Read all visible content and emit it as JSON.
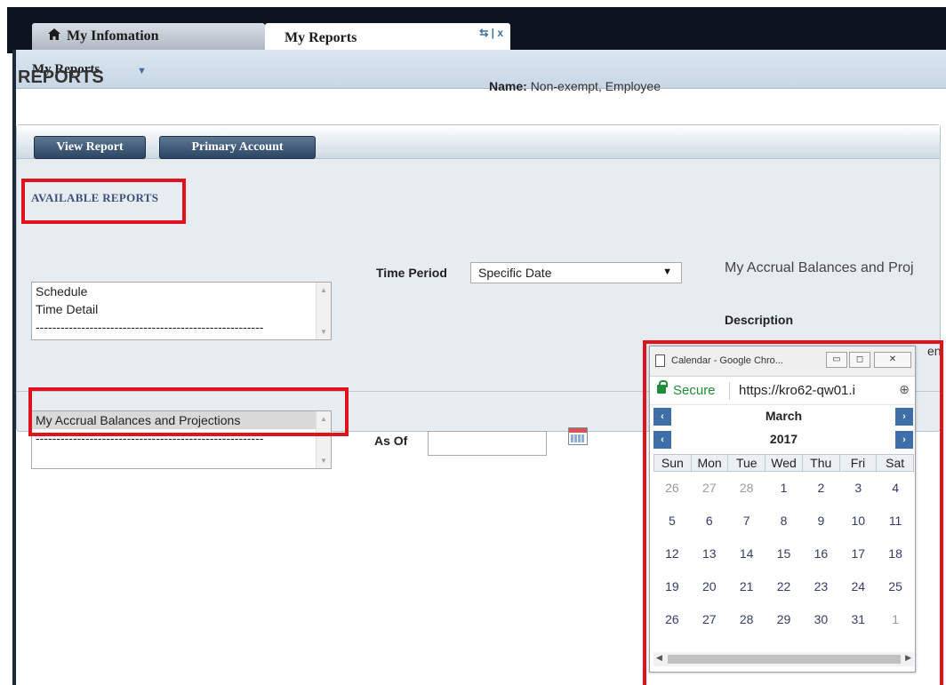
{
  "tabs": {
    "my_information": "My Infomation",
    "my_reports": "My Reports",
    "tools": "⇆ | x"
  },
  "subheader": {
    "title": "My Reports"
  },
  "page": {
    "title": "REPORTS",
    "name_label": "Name:",
    "name_value": "Non-exempt, Employee"
  },
  "toolbar": {
    "view_report": "View Report",
    "primary_account": "Primary Account"
  },
  "available_reports": {
    "title": "AVAILABLE REPORTS",
    "items": [
      "Schedule",
      "Time Detail",
      "-------------------------------------------------------"
    ],
    "accrual_items": [
      "My Accrual Balances and Projections",
      "-------------------------------------------------------"
    ]
  },
  "time_period": {
    "label": "Time Period",
    "value": "Specific Date"
  },
  "report_detail": {
    "heading": "My Accrual Balances and Proj",
    "description_label": "Description",
    "description_peek": "en"
  },
  "as_of": {
    "label": "As Of",
    "value": ""
  },
  "popup": {
    "title": "Calendar - Google Chro...",
    "secure": "Secure",
    "url": "https://kro62-qw01.i",
    "month": "March",
    "year": "2017",
    "weekdays": [
      "Sun",
      "Mon",
      "Tue",
      "Wed",
      "Thu",
      "Fri",
      "Sat"
    ],
    "weeks": [
      [
        "26",
        "27",
        "28",
        "1",
        "2",
        "3",
        "4"
      ],
      [
        "5",
        "6",
        "7",
        "8",
        "9",
        "10",
        "11"
      ],
      [
        "12",
        "13",
        "14",
        "15",
        "16",
        "17",
        "18"
      ],
      [
        "19",
        "20",
        "21",
        "22",
        "23",
        "24",
        "25"
      ],
      [
        "26",
        "27",
        "28",
        "29",
        "30",
        "31",
        "1"
      ]
    ],
    "other_month_cells": [
      "0-0",
      "0-1",
      "0-2",
      "4-6"
    ]
  },
  "colors": {
    "callout": "#e0121b",
    "button": "#2b4562",
    "calendar_nav": "#3f6fa8",
    "secure_green": "#1e8c3a"
  }
}
